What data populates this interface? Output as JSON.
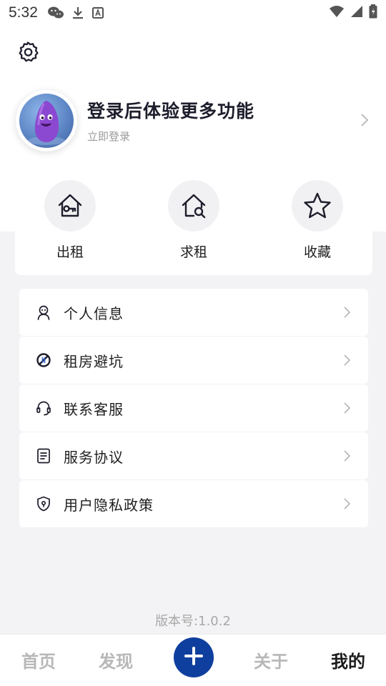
{
  "status_bar": {
    "time": "5:32",
    "left_icons": [
      "wechat-icon",
      "download-icon",
      "text-app-icon"
    ],
    "right_icons": [
      "wifi-icon",
      "signal-icon",
      "battery-icon"
    ]
  },
  "header": {
    "settings_icon": "gear-icon",
    "login_title": "登录后体验更多功能",
    "login_subtitle": "立即登录"
  },
  "quick_actions": [
    {
      "label": "出租",
      "icon": "house-key-icon"
    },
    {
      "label": "求租",
      "icon": "house-search-icon"
    },
    {
      "label": "收藏",
      "icon": "star-icon"
    }
  ],
  "menu": [
    {
      "label": "个人信息",
      "icon": "person-icon"
    },
    {
      "label": "租房避坑",
      "icon": "no-sign-icon"
    },
    {
      "label": "联系客服",
      "icon": "headset-icon"
    },
    {
      "label": "服务协议",
      "icon": "document-icon"
    },
    {
      "label": "用户隐私政策",
      "icon": "shield-lock-icon"
    }
  ],
  "version": "版本号:1.0.2",
  "tabbar": {
    "tabs": [
      "首页",
      "发现",
      "关于",
      "我的"
    ],
    "active": "我的",
    "center_icon": "plus-icon"
  },
  "colors": {
    "accent": "#0f3f9e",
    "background": "#f3f3f5",
    "inactive_tab": "#b7b7b7"
  }
}
